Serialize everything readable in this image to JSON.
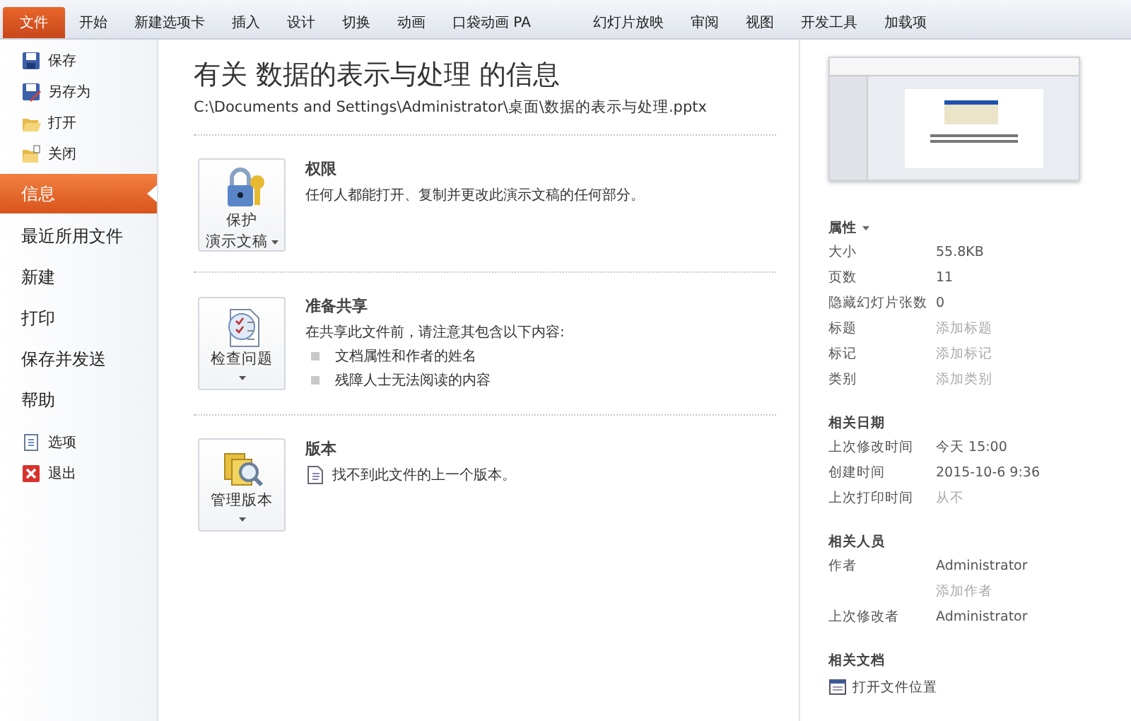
{
  "ribbon": {
    "tabs": [
      {
        "label": "文件",
        "selected": true
      },
      {
        "label": "开始",
        "selected": false
      },
      {
        "label": "新建选项卡",
        "selected": false
      },
      {
        "label": "插入",
        "selected": false
      },
      {
        "label": "设计",
        "selected": false
      },
      {
        "label": "切换",
        "selected": false
      },
      {
        "label": "动画",
        "selected": false
      },
      {
        "label": "口袋动画 PA",
        "selected": false
      },
      {
        "label": "幻灯片放映",
        "selected": false
      },
      {
        "label": "审阅",
        "selected": false
      },
      {
        "label": "视图",
        "selected": false
      },
      {
        "label": "开发工具",
        "selected": false
      },
      {
        "label": "加载项",
        "selected": false
      }
    ]
  },
  "sidebar": {
    "items": [
      {
        "kind": "small",
        "label": "保存",
        "selected": false
      },
      {
        "kind": "small",
        "label": "另存为",
        "selected": false
      },
      {
        "kind": "small",
        "label": "打开",
        "selected": false
      },
      {
        "kind": "small",
        "label": "关闭",
        "selected": false
      },
      {
        "kind": "big",
        "label": "信息",
        "selected": true
      },
      {
        "kind": "big",
        "label": "最近所用文件",
        "selected": false
      },
      {
        "kind": "big",
        "label": "新建",
        "selected": false
      },
      {
        "kind": "big",
        "label": "打印",
        "selected": false
      },
      {
        "kind": "big",
        "label": "保存并发送",
        "selected": false
      },
      {
        "kind": "big",
        "label": "帮助",
        "selected": false
      },
      {
        "kind": "small",
        "label": "选项",
        "selected": false
      },
      {
        "kind": "small",
        "label": "退出",
        "selected": false
      }
    ]
  },
  "info": {
    "title": "有关 数据的表示与处理 的信息",
    "path": "C:\\Documents and Settings\\Administrator\\桌面\\数据的表示与处理.pptx",
    "sections": [
      {
        "button_lines": [
          "保护",
          "演示文稿"
        ],
        "heading": "权限",
        "text": "任何人都能打开、复制并更改此演示文稿的任何部分。"
      },
      {
        "button_lines": [
          "检查问题"
        ],
        "heading": "准备共享",
        "text": "在共享此文件前，请注意其包含以下内容:",
        "bullets": [
          "文档属性和作者的姓名",
          "残障人士无法阅读的内容"
        ]
      },
      {
        "button_lines": [
          "管理版本"
        ],
        "heading": "版本",
        "note": "找不到此文件的上一个版本。"
      }
    ]
  },
  "properties": {
    "heading": "属性",
    "groups": [
      {
        "rows": [
          {
            "label": "大小",
            "values": [
              {
                "text": "55.8KB",
                "muted": false
              }
            ]
          },
          {
            "label": "页数",
            "values": [
              {
                "text": "11",
                "muted": false
              }
            ]
          },
          {
            "label": "隐藏幻灯片张数",
            "values": [
              {
                "text": "0",
                "muted": false
              }
            ]
          },
          {
            "label": "标题",
            "values": [
              {
                "text": "添加标题",
                "muted": true
              }
            ]
          },
          {
            "label": "标记",
            "values": [
              {
                "text": "添加标记",
                "muted": true
              }
            ]
          },
          {
            "label": "类别",
            "values": [
              {
                "text": "添加类别",
                "muted": true
              }
            ]
          }
        ]
      },
      {
        "heading": "相关日期",
        "rows": [
          {
            "label": "上次修改时间",
            "values": [
              {
                "text": "今天 15:00",
                "muted": false
              }
            ]
          },
          {
            "label": "创建时间",
            "values": [
              {
                "text": "2015-10-6 9:36",
                "muted": false
              }
            ]
          },
          {
            "label": "上次打印时间",
            "values": [
              {
                "text": "从不",
                "muted": true
              }
            ]
          }
        ]
      },
      {
        "heading": "相关人员",
        "rows": [
          {
            "label": "作者",
            "values": [
              {
                "text": "Administrator",
                "muted": false
              },
              {
                "text": "添加作者",
                "muted": true
              }
            ]
          },
          {
            "label": "上次修改者",
            "values": [
              {
                "text": "Administrator",
                "muted": false
              }
            ]
          }
        ]
      }
    ],
    "documents": {
      "heading": "相关文档",
      "link": "打开文件位置"
    }
  }
}
